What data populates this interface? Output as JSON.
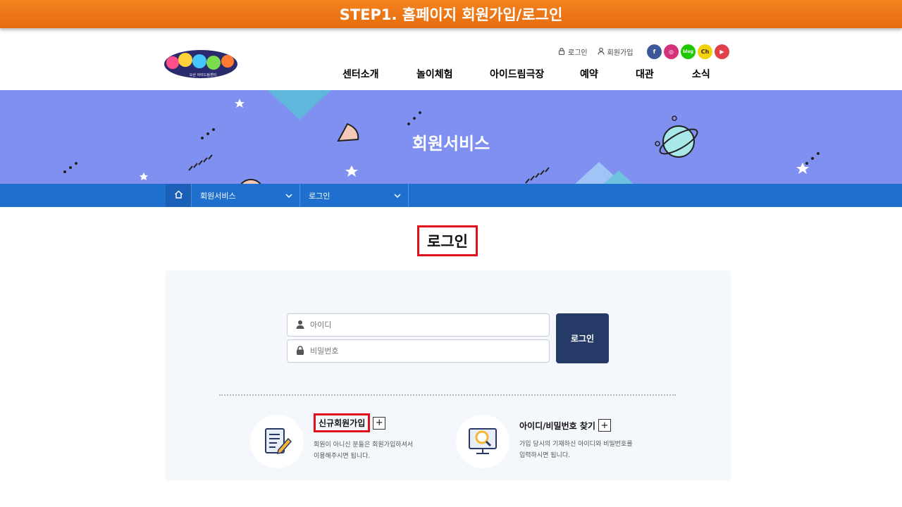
{
  "banner": {
    "text": "STEP1. 홈페이지 회원가입/로그인"
  },
  "header": {
    "logo_alt": "오산 아이드림센터",
    "util": {
      "login": "로그인",
      "join": "회원가입"
    },
    "sns": [
      {
        "name": "facebook-icon",
        "label": "f",
        "color": "#3b5998"
      },
      {
        "name": "instagram-icon",
        "label": "◎",
        "color": "#d6307a"
      },
      {
        "name": "blog-icon",
        "label": "blog",
        "color": "#1ec800"
      },
      {
        "name": "kakao-channel-icon",
        "label": "Ch",
        "color": "#f2d20a"
      },
      {
        "name": "youtube-icon",
        "label": "▶",
        "color": "#e0404a"
      }
    ],
    "gnb": [
      "센터소개",
      "놀이체험",
      "아이드림극장",
      "예약",
      "대관",
      "소식"
    ]
  },
  "visual": {
    "title": "회원서비스"
  },
  "breadcrumb": {
    "depth1": "회원서비스",
    "depth2": "로그인"
  },
  "page_title": "로그인",
  "login_form": {
    "id_placeholder": "아이디",
    "pw_placeholder": "비밀번호",
    "submit": "로그인"
  },
  "services": {
    "join": {
      "title": "신규회원가입",
      "desc1": "회원이 아니신 분들은 회원가입하셔서",
      "desc2": "이용해주시면 됩니다."
    },
    "find": {
      "title": "아이디/비밀번호 찾기",
      "desc1": "가입 당시의 기재하신 아이디와 비밀번호를",
      "desc2": "입력하시면 됩니다."
    }
  },
  "colors": {
    "banner": "#f5821f",
    "visual_bg": "#8090f0",
    "breadcrumb_bg": "#1f6fcf",
    "login_button": "#253a66",
    "highlight": "#e0101a"
  }
}
